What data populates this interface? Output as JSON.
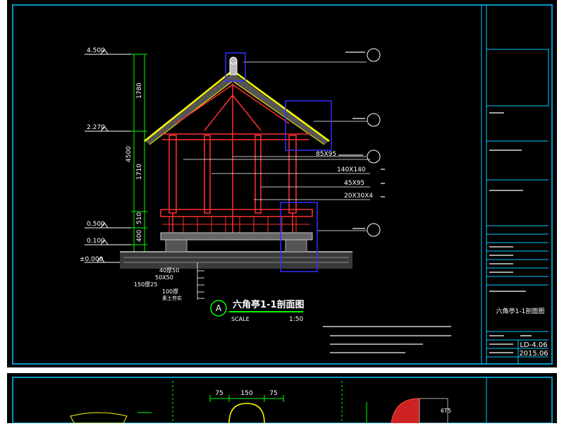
{
  "elevations": [
    "4.500",
    "2.270",
    "0.500",
    "0.100",
    "±0.000"
  ],
  "vertical_dims": [
    "1780",
    "4500",
    "1710",
    "510",
    "400"
  ],
  "section_labels": [
    "85X95",
    "140X140",
    "45X95",
    "20X30X4"
  ],
  "layer_labels": [
    "40厚50",
    "50X50",
    "150厚25",
    "100厚",
    "素土夯实"
  ],
  "title": {
    "badge": "A",
    "text": "六角亭1-1剖面图",
    "scale_label": "SCALE",
    "scale_value": "1:50"
  },
  "title_block": {
    "drawing_name": "六角亭1-1剖面图",
    "drawing_no": "LD-4.06",
    "date": "2015.06"
  },
  "bottom_dims": [
    "75",
    "150",
    "75"
  ],
  "bottom_label": "6T5",
  "colors": {
    "background": "#000000",
    "frame": "#00c8ff",
    "roof_outline": "#ffff00",
    "timber": "#ff3030",
    "callout": "#3030ff",
    "dimension": "#00ff00",
    "text": "#ffffff"
  }
}
